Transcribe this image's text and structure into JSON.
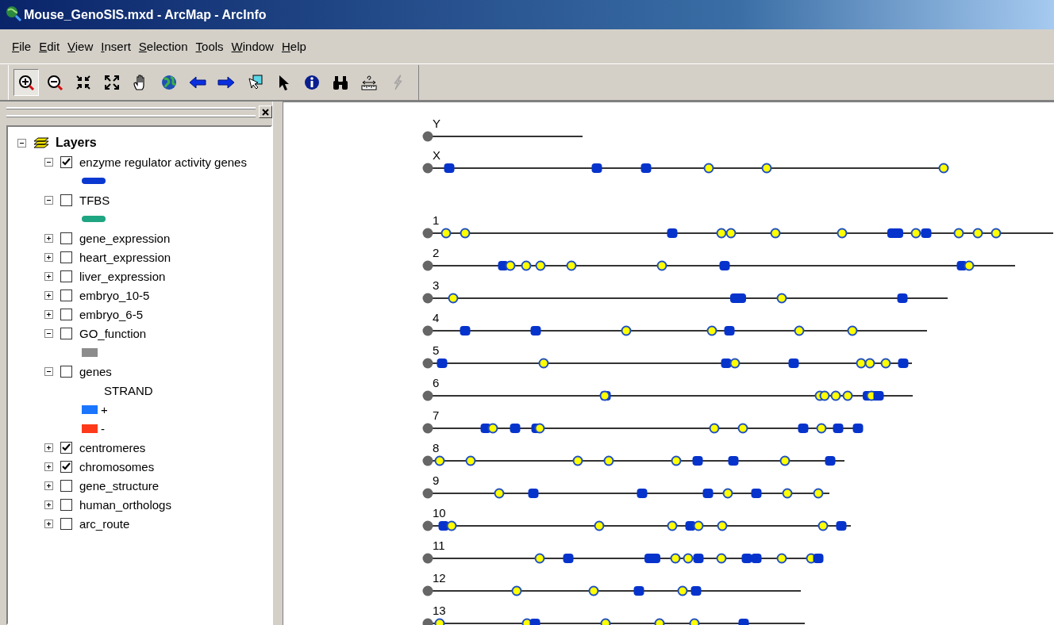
{
  "window": {
    "title": "Mouse_GenoSIS.mxd - ArcMap - ArcInfo"
  },
  "menu": [
    "File",
    "Edit",
    "View",
    "Insert",
    "Selection",
    "Tools",
    "Window",
    "Help"
  ],
  "toolbar": [
    {
      "kind": "zoom-in",
      "selected": true,
      "disabled": false
    },
    {
      "kind": "zoom-out",
      "selected": false,
      "disabled": false
    },
    {
      "kind": "fixed-zoom-in",
      "selected": false,
      "disabled": false
    },
    {
      "kind": "fixed-zoom-out",
      "selected": false,
      "disabled": false
    },
    {
      "kind": "pan",
      "selected": false,
      "disabled": false
    },
    {
      "kind": "full-extent",
      "selected": false,
      "disabled": false
    },
    {
      "kind": "back",
      "selected": false,
      "disabled": false
    },
    {
      "kind": "forward",
      "selected": false,
      "disabled": false
    },
    {
      "kind": "select-features",
      "selected": false,
      "disabled": false
    },
    {
      "kind": "select-elements",
      "selected": false,
      "disabled": false
    },
    {
      "kind": "identify",
      "selected": false,
      "disabled": false
    },
    {
      "kind": "find",
      "selected": false,
      "disabled": false
    },
    {
      "kind": "measure",
      "selected": false,
      "disabled": false
    },
    {
      "kind": "hyperlink",
      "selected": false,
      "disabled": true
    }
  ],
  "table_of_contents": {
    "root": {
      "label": "Layers",
      "expanded": true,
      "children": [
        {
          "label": "enzyme regulator activity genes",
          "expanded": true,
          "checked": true,
          "legend": [
            {
              "kind": "line",
              "color": "#0a38d0"
            }
          ]
        },
        {
          "label": "TFBS",
          "expanded": true,
          "checked": false,
          "legend": [
            {
              "kind": "line",
              "color": "#1ea582"
            }
          ]
        },
        {
          "label": "gene_expression",
          "expanded": false,
          "checked": false
        },
        {
          "label": "heart_expression",
          "expanded": false,
          "checked": false
        },
        {
          "label": "liver_expression",
          "expanded": false,
          "checked": false
        },
        {
          "label": "embryo_10-5",
          "expanded": false,
          "checked": false
        },
        {
          "label": "embryo_6-5",
          "expanded": false,
          "checked": false
        },
        {
          "label": "GO_function",
          "expanded": true,
          "checked": false,
          "legend": [
            {
              "kind": "patch",
              "color": "#8c8c8c"
            }
          ]
        },
        {
          "label": "genes",
          "expanded": true,
          "checked": false,
          "legend_heading": "STRAND",
          "legend": [
            {
              "kind": "patch",
              "label": "+",
              "color": "#1a75ff"
            },
            {
              "kind": "patch",
              "label": "-",
              "color": "#ff3a1a"
            }
          ]
        },
        {
          "label": "centromeres",
          "expanded": false,
          "checked": true
        },
        {
          "label": "chromosomes",
          "expanded": false,
          "checked": true
        },
        {
          "label": "gene_structure",
          "expanded": false,
          "checked": false
        },
        {
          "label": "human_orthologs",
          "expanded": false,
          "checked": false
        },
        {
          "label": "arc_route",
          "expanded": false,
          "checked": false
        }
      ]
    }
  },
  "map": {
    "chromosomes": [
      {
        "label": "Y"
      },
      {
        "label": "X"
      },
      {
        "label": "1"
      },
      {
        "label": "2"
      },
      {
        "label": "3"
      },
      {
        "label": "4"
      },
      {
        "label": "5"
      },
      {
        "label": "6"
      },
      {
        "label": "7"
      },
      {
        "label": "8"
      },
      {
        "label": "9"
      },
      {
        "label": "10"
      },
      {
        "label": "11"
      },
      {
        "label": "12"
      },
      {
        "label": "13"
      }
    ]
  }
}
